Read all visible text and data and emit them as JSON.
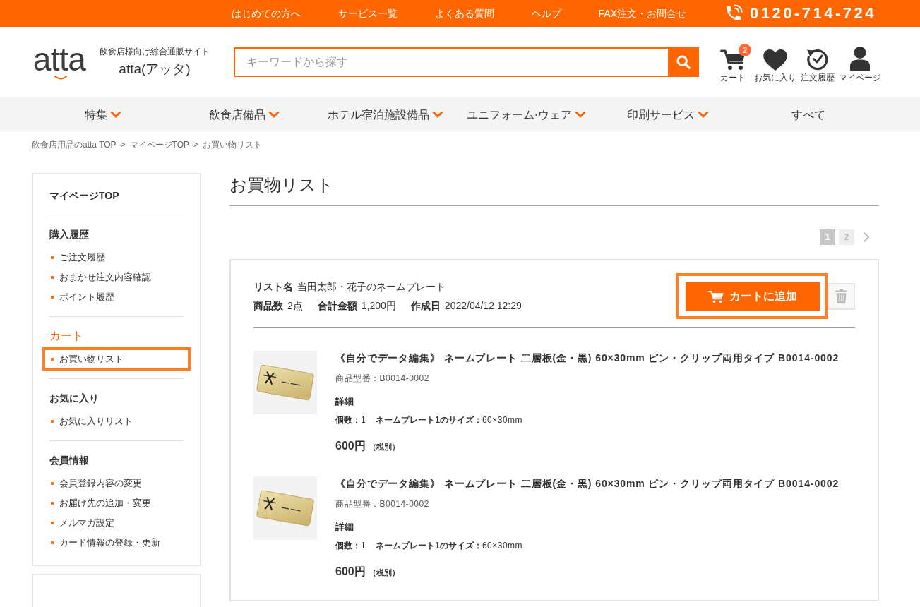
{
  "top_bar": {
    "links": [
      "はじめての方へ",
      "サービス一覧",
      "よくある質問",
      "ヘルプ",
      "FAX注文・お問合せ"
    ],
    "phone": "0120-714-724"
  },
  "header": {
    "logo": "atta",
    "tagline": "飲食店様向け総合通販サイト",
    "site_name": "atta(アッタ)",
    "search": {
      "placeholder": "キーワードから探す"
    },
    "icons": [
      {
        "kind": "cart",
        "label": "カート",
        "badge": "2"
      },
      {
        "kind": "heart",
        "label": "お気に入り"
      },
      {
        "kind": "history",
        "label": "注文履歴"
      },
      {
        "kind": "user",
        "label": "マイページ"
      }
    ]
  },
  "nav": [
    {
      "label": "特集",
      "dropdown": true
    },
    {
      "label": "飲食店備品",
      "dropdown": true
    },
    {
      "label": "ホテル宿泊施設備品",
      "dropdown": true
    },
    {
      "label": "ユニフォーム·ウェア",
      "dropdown": true
    },
    {
      "label": "印刷サービス",
      "dropdown": true
    },
    {
      "label": "すべて",
      "dropdown": false
    }
  ],
  "breadcrumb": [
    {
      "label": "飲食店用品のatta TOP",
      "separator": ">"
    },
    {
      "label": "マイページTOP",
      "separator": ">"
    },
    {
      "label": "お買い物リスト"
    }
  ],
  "sidebar": {
    "sections": [
      {
        "title": "マイページTOP",
        "active": false
      },
      {
        "title": "購入履歴",
        "active": false,
        "items": [
          {
            "label": "ご注文履歴",
            "selected": false
          },
          {
            "label": "おまかせ注文内容確認",
            "selected": false
          },
          {
            "label": "ポイント履歴",
            "selected": false
          }
        ]
      },
      {
        "title": "カート",
        "active": true,
        "items": [
          {
            "label": "お買い物リスト",
            "selected": true
          }
        ]
      },
      {
        "title": "お気に入り",
        "active": false,
        "items": [
          {
            "label": "お気に入りリスト",
            "selected": false
          }
        ]
      },
      {
        "title": "会員情報",
        "active": false,
        "items": [
          {
            "label": "会員登録内容の変更",
            "selected": false
          },
          {
            "label": "お届け先の追加・変更",
            "selected": false
          },
          {
            "label": "メルマガ設定",
            "selected": false
          },
          {
            "label": "カード情報の登録・更新",
            "selected": false
          }
        ]
      }
    ]
  },
  "page_title": "お買物リスト",
  "pagination": {
    "pages": [
      {
        "label": "1",
        "selected": true
      },
      {
        "label": "2",
        "selected": false
      }
    ]
  },
  "list": {
    "name_label": "リスト名",
    "name": "当田太郎・花子のネームプレート",
    "meta": [
      {
        "label": "商品数",
        "value": "2点"
      },
      {
        "label": "合計金額",
        "value": "1,200円"
      },
      {
        "label": "作成日",
        "value": "2022/04/12 12:29"
      }
    ],
    "add_button": {
      "label": "カートに追加",
      "highlighted": true
    },
    "items": [
      {
        "title": "《自分でデータ編集》 ネームプレート 二層板(金・黒) 60×30mm ピン・クリップ両用タイプ B0014-0002",
        "code": "商品型番：B0014-0002",
        "details_heading": "詳細",
        "details": [
          {
            "label": "個数：",
            "value": "1"
          },
          {
            "label": "ネームプレート1のサイズ：",
            "value": "60×30mm"
          }
        ],
        "price": "600円",
        "tax_note": "（税別）"
      },
      {
        "title": "《自分でデータ編集》 ネームプレート 二層板(金・黒) 60×30mm ピン・クリップ両用タイプ B0014-0002",
        "code": "商品型番：B0014-0002",
        "details_heading": "詳細",
        "details": [
          {
            "label": "個数：",
            "value": "1"
          },
          {
            "label": "ネームプレート1のサイズ：",
            "value": "60×30mm"
          }
        ],
        "price": "600円",
        "tax_note": "（税別）"
      }
    ]
  }
}
